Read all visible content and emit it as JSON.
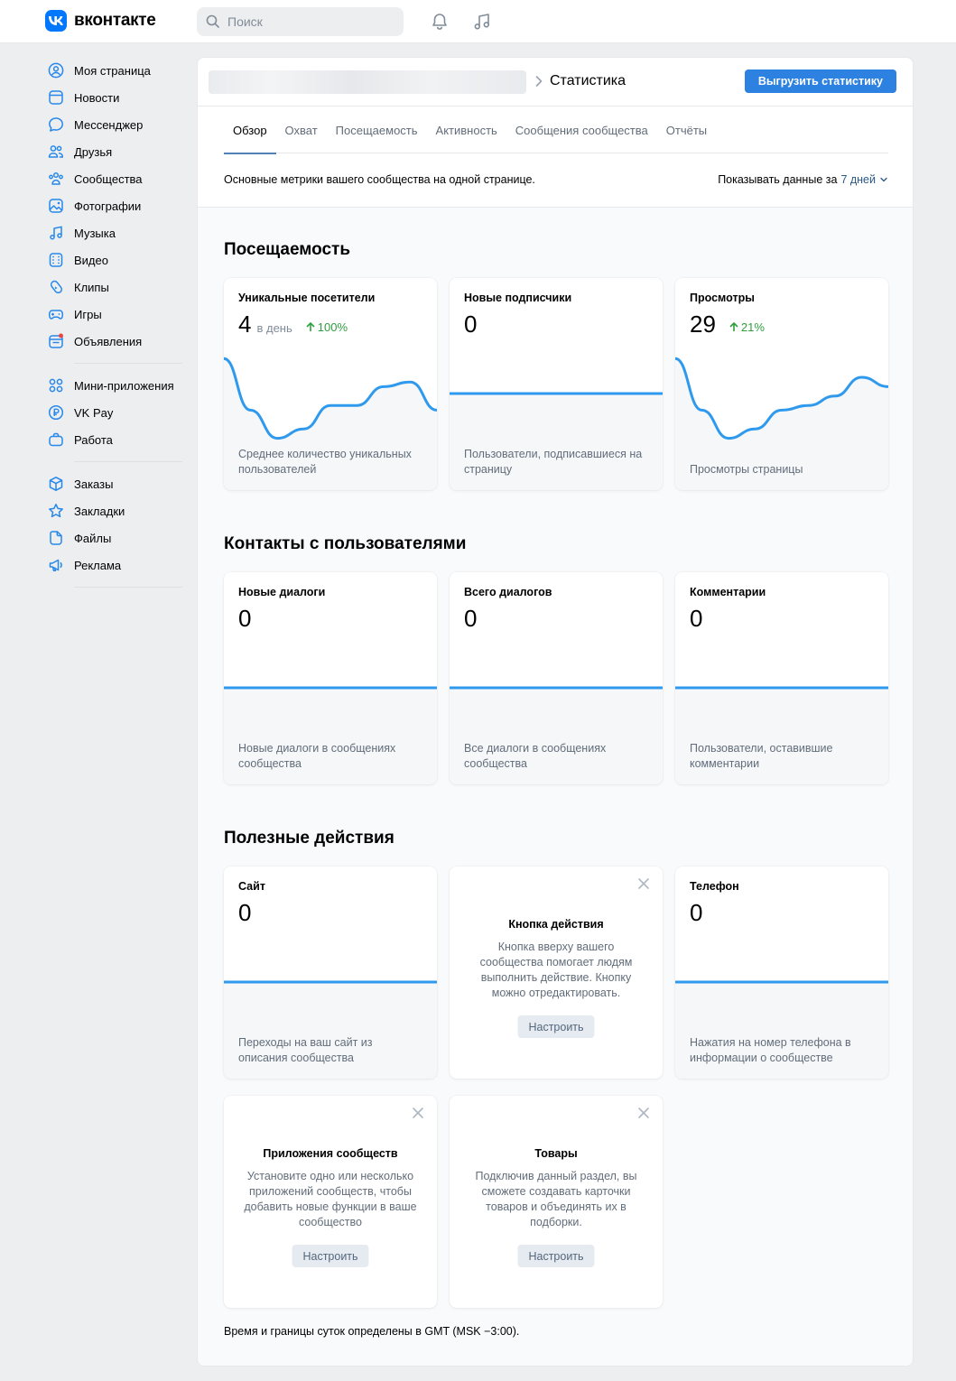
{
  "brand": {
    "name": "вконтакте",
    "logo_letter": "VK"
  },
  "search": {
    "placeholder": "Поиск"
  },
  "topbar_icons": [
    "bell-icon",
    "music-icon"
  ],
  "sidebar": {
    "groups": [
      [
        {
          "label": "Моя страница",
          "icon": "user-circle-icon"
        },
        {
          "label": "Новости",
          "icon": "newsfeed-icon"
        },
        {
          "label": "Мессенджер",
          "icon": "message-icon"
        },
        {
          "label": "Друзья",
          "icon": "friends-icon"
        },
        {
          "label": "Сообщества",
          "icon": "communities-icon"
        },
        {
          "label": "Фотографии",
          "icon": "photos-icon"
        },
        {
          "label": "Музыка",
          "icon": "music-icon"
        },
        {
          "label": "Видео",
          "icon": "video-icon"
        },
        {
          "label": "Клипы",
          "icon": "clips-icon"
        },
        {
          "label": "Игры",
          "icon": "gamepad-icon"
        },
        {
          "label": "Объявления",
          "icon": "ads-board-icon"
        }
      ],
      [
        {
          "label": "Мини-приложения",
          "icon": "mini-apps-icon"
        },
        {
          "label": "VK Pay",
          "icon": "vk-pay-icon"
        },
        {
          "label": "Работа",
          "icon": "work-bag-icon"
        }
      ],
      [
        {
          "label": "Заказы",
          "icon": "orders-box-icon"
        },
        {
          "label": "Закладки",
          "icon": "bookmark-star-icon"
        },
        {
          "label": "Файлы",
          "icon": "file-icon"
        },
        {
          "label": "Реклама",
          "icon": "megaphone-icon"
        }
      ]
    ]
  },
  "header": {
    "title": "Статистика",
    "export_button": "Выгрузить статистику"
  },
  "tabs": [
    {
      "label": "Обзор",
      "active": true
    },
    {
      "label": "Охват",
      "active": false
    },
    {
      "label": "Посещаемость",
      "active": false
    },
    {
      "label": "Активность",
      "active": false
    },
    {
      "label": "Сообщения сообщества",
      "active": false
    },
    {
      "label": "Отчёты",
      "active": false
    }
  ],
  "overview": {
    "description": "Основные метрики вашего сообщества на одной странице.",
    "period_prefix": "Показывать данные за",
    "period_value": "7 дней"
  },
  "sections": {
    "attendance": {
      "title": "Посещаемость",
      "cards": [
        {
          "label": "Уникальные посетители",
          "value": "4",
          "unit": "в день",
          "trend": "100%",
          "note": "Среднее количество уникальных пользователей",
          "series": [
            95,
            40,
            10,
            20,
            45,
            45,
            65,
            70,
            40
          ]
        },
        {
          "label": "Новые подписчики",
          "value": "0",
          "unit": "",
          "trend": "",
          "note": "Пользователи, подписавшиеся на страницу",
          "series": [
            0,
            0,
            0,
            0,
            0,
            0,
            0,
            0,
            0
          ]
        },
        {
          "label": "Просмотры",
          "value": "29",
          "unit": "",
          "trend": "21%",
          "note": "Просмотры страницы",
          "series": [
            95,
            40,
            10,
            20,
            40,
            45,
            55,
            75,
            65
          ]
        }
      ]
    },
    "contacts": {
      "title": "Контакты с пользователями",
      "cards": [
        {
          "label": "Новые диалоги",
          "value": "0",
          "note": "Новые диалоги в сообщениях сообщества"
        },
        {
          "label": "Всего диалогов",
          "value": "0",
          "note": "Все диалоги в сообщениях сообщества"
        },
        {
          "label": "Комментарии",
          "value": "0",
          "note": "Пользователи, оставившие комментарии"
        }
      ]
    },
    "useful": {
      "title": "Полезные действия",
      "site": {
        "label": "Сайт",
        "value": "0",
        "note": "Переходы на ваш сайт из описания сообщества"
      },
      "phone": {
        "label": "Телефон",
        "value": "0",
        "note": "Нажатия на номер телефона в информации о сообществе"
      },
      "promos": [
        {
          "title": "Кнопка действия",
          "text": "Кнопка вверху вашего сообщества помогает людям выполнить действие. Кнопку можно отредактировать.",
          "button": "Настроить"
        },
        {
          "title": "Приложения сообществ",
          "text": "Установите одно или несколько приложений сообществ, чтобы добавить новые функции в ваше сообщество",
          "button": "Настроить"
        },
        {
          "title": "Товары",
          "text": "Подключив данный раздел, вы сможете создавать карточки товаров и объединять их в подборки.",
          "button": "Настроить"
        }
      ]
    }
  },
  "footnote": "Время и границы суток определены в GMT (MSK −3:00).",
  "colors": {
    "accent": "#2d81e0",
    "chart_line": "#2f9aed",
    "trend_up": "#2e9e3e",
    "link": "#2a5885"
  }
}
